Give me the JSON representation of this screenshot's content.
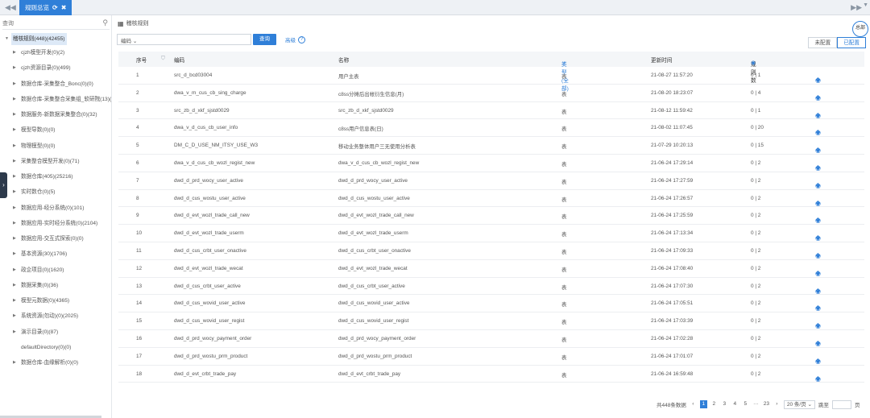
{
  "tabbar": {
    "tab_label": "规则总览",
    "nav_left": "◀◀",
    "nav_right": "▶▶",
    "caret": "▼",
    "refresh": "⟳",
    "close": "✖"
  },
  "sidebar": {
    "search_placeholder": "查询",
    "root": "稽核规则(448)(42455)",
    "items": [
      {
        "label": "cjzh模型开发(0)(2)",
        "arrow": true
      },
      {
        "label": "cjzh资源目录(0)(499)",
        "arrow": true
      },
      {
        "label": "数据仓库-采集整合_Bonc(0)(0)",
        "arrow": true
      },
      {
        "label": "数据仓库-采集整合采集组_软研院(13)(",
        "arrow": true
      },
      {
        "label": "数据服务-新数据采集整合(0)(32)",
        "arrow": true
      },
      {
        "label": "模型导数(0)(0)",
        "arrow": true
      },
      {
        "label": "物理模型(0)(0)",
        "arrow": true
      },
      {
        "label": "采集整合模型开发(0)(71)",
        "arrow": true
      },
      {
        "label": "数据仓库(405)(25216)",
        "arrow": true
      },
      {
        "label": "实时数仓(0)(5)",
        "arrow": true
      },
      {
        "label": "数据应用-经分系统(0)(101)",
        "arrow": true
      },
      {
        "label": "数据应用-实时经分系统(0)(2104)",
        "arrow": true
      },
      {
        "label": "数据应用-交互式探索(0)(0)",
        "arrow": true
      },
      {
        "label": "基本资源(30)(1706)",
        "arrow": true
      },
      {
        "label": "政企项目(0)(1620)",
        "arrow": true
      },
      {
        "label": "数据采集(0)(36)",
        "arrow": true
      },
      {
        "label": "模型元数据(0)(4365)",
        "arrow": true
      },
      {
        "label": "系统资源(勿动)(0)(2025)",
        "arrow": true
      },
      {
        "label": "演示目录(0)(87)",
        "arrow": true
      },
      {
        "label": "defaultDirectory(0)(0)",
        "arrow": false
      },
      {
        "label": "数据仓库-血缘解析(0)(0)",
        "arrow": true
      }
    ]
  },
  "main": {
    "breadcrumb": "稽核规则",
    "all_label": "总部",
    "filter_select": "编码",
    "query_btn": "查询",
    "advanced": "高级",
    "seg_unconfigured": "未配置",
    "seg_configured": "已配置"
  },
  "table": {
    "headers": {
      "no": "序号",
      "code": "编码",
      "name": "名称",
      "type": "类型(全部)",
      "time": "更新时间",
      "rules": "规则数"
    },
    "rows": [
      {
        "no": "1",
        "code": "src_d_bcd03004",
        "name": "用户主表",
        "type": "表",
        "time": "21-08-27 11:57:20",
        "rules": "0 | 1"
      },
      {
        "no": "2",
        "code": "dwa_v_m_cus_cb_sing_charge",
        "name": "c8ss分摊后出帐衍生信息(月)",
        "type": "表",
        "time": "21-08-20 18:23:07",
        "rules": "0 | 4"
      },
      {
        "no": "3",
        "code": "src_zb_d_xkf_sjstd0029",
        "name": "src_zb_d_xkf_sjstd0029",
        "type": "表",
        "time": "21-08-12 11:59:42",
        "rules": "0 | 1"
      },
      {
        "no": "4",
        "code": "dwa_v_d_cus_cb_user_info",
        "name": "c8ss用户信息表(日)",
        "type": "表",
        "time": "21-08-02 11:07:45",
        "rules": "0 | 20"
      },
      {
        "no": "5",
        "code": "DM_C_D_USE_NM_ITSY_USE_W3",
        "name": "移动业务整体用户三无使用分析表",
        "type": "表",
        "time": "21-07-29 10:20:13",
        "rules": "0 | 15"
      },
      {
        "no": "6",
        "code": "dwa_v_d_cus_cb_wozl_regist_new",
        "name": "dwa_v_d_cus_cb_wozl_regist_new",
        "type": "表",
        "time": "21-06-24 17:29:14",
        "rules": "0 | 2"
      },
      {
        "no": "7",
        "code": "dwd_d_prd_wocy_user_active",
        "name": "dwd_d_prd_wocy_user_active",
        "type": "表",
        "time": "21-06-24 17:27:59",
        "rules": "0 | 2"
      },
      {
        "no": "8",
        "code": "dwd_d_cus_wostu_user_active",
        "name": "dwd_d_cus_wostu_user_active",
        "type": "表",
        "time": "21-06-24 17:26:57",
        "rules": "0 | 2"
      },
      {
        "no": "9",
        "code": "dwd_d_evt_wozl_trade_call_new",
        "name": "dwd_d_evt_wozl_trade_call_new",
        "type": "表",
        "time": "21-06-24 17:25:59",
        "rules": "0 | 2"
      },
      {
        "no": "10",
        "code": "dwd_d_evt_wozl_trade_userm",
        "name": "dwd_d_evt_wozl_trade_userm",
        "type": "表",
        "time": "21-06-24 17:13:34",
        "rules": "0 | 2"
      },
      {
        "no": "11",
        "code": "dwd_d_cus_crbt_user_onactive",
        "name": "dwd_d_cus_crbt_user_onactive",
        "type": "表",
        "time": "21-06-24 17:09:33",
        "rules": "0 | 2"
      },
      {
        "no": "12",
        "code": "dwd_d_evt_wozl_trade_wecat",
        "name": "dwd_d_evt_wozl_trade_wecat",
        "type": "表",
        "time": "21-06-24 17:08:40",
        "rules": "0 | 2"
      },
      {
        "no": "13",
        "code": "dwd_d_cus_crbt_user_active",
        "name": "dwd_d_cus_crbt_user_active",
        "type": "表",
        "time": "21-06-24 17:07:30",
        "rules": "0 | 2"
      },
      {
        "no": "14",
        "code": "dwd_d_cus_wovid_user_active",
        "name": "dwd_d_cus_wovid_user_active",
        "type": "表",
        "time": "21-06-24 17:05:51",
        "rules": "0 | 2"
      },
      {
        "no": "15",
        "code": "dwd_d_cus_wovid_user_regist",
        "name": "dwd_d_cus_wovid_user_regist",
        "type": "表",
        "time": "21-06-24 17:03:39",
        "rules": "0 | 2"
      },
      {
        "no": "16",
        "code": "dwd_d_prd_wocy_payment_order",
        "name": "dwd_d_prd_wocy_payment_order",
        "type": "表",
        "time": "21-06-24 17:02:28",
        "rules": "0 | 2"
      },
      {
        "no": "17",
        "code": "dwd_d_prd_wostu_prm_product",
        "name": "dwd_d_prd_wostu_prm_product",
        "type": "表",
        "time": "21-06-24 17:01:07",
        "rules": "0 | 2"
      },
      {
        "no": "18",
        "code": "dwd_d_evt_crbt_trade_pay",
        "name": "dwd_d_evt_crbt_trade_pay",
        "type": "表",
        "time": "21-06-24 16:59:48",
        "rules": "0 | 2"
      }
    ]
  },
  "pager": {
    "total": "共448条数据",
    "pages": [
      "1",
      "2",
      "3",
      "4",
      "5",
      "···",
      "23"
    ],
    "prev": "‹",
    "next": "›",
    "size": "20 条/页",
    "goto": "跳至",
    "page_unit": "页"
  },
  "colors": {
    "accent": "#2f7fd8",
    "sidebar_toggle": "#2d3a4b"
  }
}
